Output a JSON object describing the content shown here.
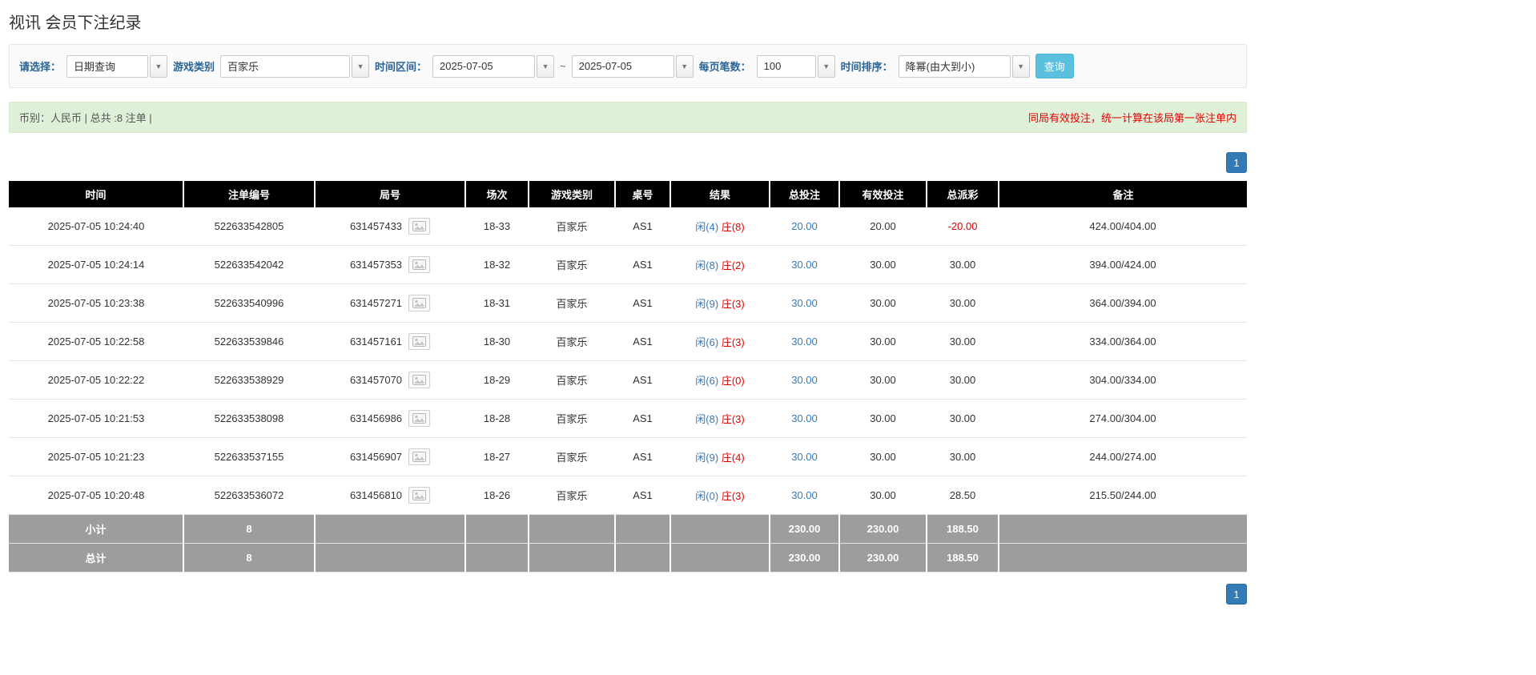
{
  "page": {
    "title": "视讯 会员下注纪录"
  },
  "filters": {
    "select_label": "请选择：",
    "select_value": "日期查询",
    "game_type_label": "游戏类别",
    "game_type_value": "百家乐",
    "time_range_label": "时间区间：",
    "date_from": "2025-07-05",
    "tilde": "~",
    "date_to": "2025-07-05",
    "page_size_label": "每页笔数：",
    "page_size_value": "100",
    "sort_label": "时间排序：",
    "sort_value": "降幂(由大到小)",
    "search_button": "查询"
  },
  "summary": {
    "left": "币别：人民币 | 总共 :8 注单 |",
    "right": "同局有效投注，统一计算在该局第一张注单内"
  },
  "pagination": {
    "page": "1"
  },
  "table": {
    "headers": [
      "时间",
      "注单编号",
      "局号",
      "场次",
      "游戏类别",
      "桌号",
      "结果",
      "总投注",
      "有效投注",
      "总派彩",
      "备注"
    ],
    "rows": [
      {
        "time": "2025-07-05 10:24:40",
        "bet_id": "522633542805",
        "round_id": "631457433",
        "session": "18-33",
        "game": "百家乐",
        "table_no": "AS1",
        "result_player": "闲(4)",
        "result_banker": "庄(8)",
        "total_bet": "20.00",
        "valid_bet": "20.00",
        "payout": "-20.00",
        "remark": "424.00/404.00"
      },
      {
        "time": "2025-07-05 10:24:14",
        "bet_id": "522633542042",
        "round_id": "631457353",
        "session": "18-32",
        "game": "百家乐",
        "table_no": "AS1",
        "result_player": "闲(8)",
        "result_banker": "庄(2)",
        "total_bet": "30.00",
        "valid_bet": "30.00",
        "payout": "30.00",
        "remark": "394.00/424.00"
      },
      {
        "time": "2025-07-05 10:23:38",
        "bet_id": "522633540996",
        "round_id": "631457271",
        "session": "18-31",
        "game": "百家乐",
        "table_no": "AS1",
        "result_player": "闲(9)",
        "result_banker": "庄(3)",
        "total_bet": "30.00",
        "valid_bet": "30.00",
        "payout": "30.00",
        "remark": "364.00/394.00"
      },
      {
        "time": "2025-07-05 10:22:58",
        "bet_id": "522633539846",
        "round_id": "631457161",
        "session": "18-30",
        "game": "百家乐",
        "table_no": "AS1",
        "result_player": "闲(6)",
        "result_banker": "庄(3)",
        "total_bet": "30.00",
        "valid_bet": "30.00",
        "payout": "30.00",
        "remark": "334.00/364.00"
      },
      {
        "time": "2025-07-05 10:22:22",
        "bet_id": "522633538929",
        "round_id": "631457070",
        "session": "18-29",
        "game": "百家乐",
        "table_no": "AS1",
        "result_player": "闲(6)",
        "result_banker": "庄(0)",
        "total_bet": "30.00",
        "valid_bet": "30.00",
        "payout": "30.00",
        "remark": "304.00/334.00"
      },
      {
        "time": "2025-07-05 10:21:53",
        "bet_id": "522633538098",
        "round_id": "631456986",
        "session": "18-28",
        "game": "百家乐",
        "table_no": "AS1",
        "result_player": "闲(8)",
        "result_banker": "庄(3)",
        "total_bet": "30.00",
        "valid_bet": "30.00",
        "payout": "30.00",
        "remark": "274.00/304.00"
      },
      {
        "time": "2025-07-05 10:21:23",
        "bet_id": "522633537155",
        "round_id": "631456907",
        "session": "18-27",
        "game": "百家乐",
        "table_no": "AS1",
        "result_player": "闲(9)",
        "result_banker": "庄(4)",
        "total_bet": "30.00",
        "valid_bet": "30.00",
        "payout": "30.00",
        "remark": "244.00/274.00"
      },
      {
        "time": "2025-07-05 10:20:48",
        "bet_id": "522633536072",
        "round_id": "631456810",
        "session": "18-26",
        "game": "百家乐",
        "table_no": "AS1",
        "result_player": "闲(0)",
        "result_banker": "庄(3)",
        "total_bet": "30.00",
        "valid_bet": "30.00",
        "payout": "28.50",
        "remark": "215.50/244.00"
      }
    ],
    "subtotal": {
      "label": "小计",
      "count": "8",
      "total_bet": "230.00",
      "valid_bet": "230.00",
      "payout": "188.50"
    },
    "total": {
      "label": "总计",
      "count": "8",
      "total_bet": "230.00",
      "valid_bet": "230.00",
      "payout": "188.50"
    }
  }
}
